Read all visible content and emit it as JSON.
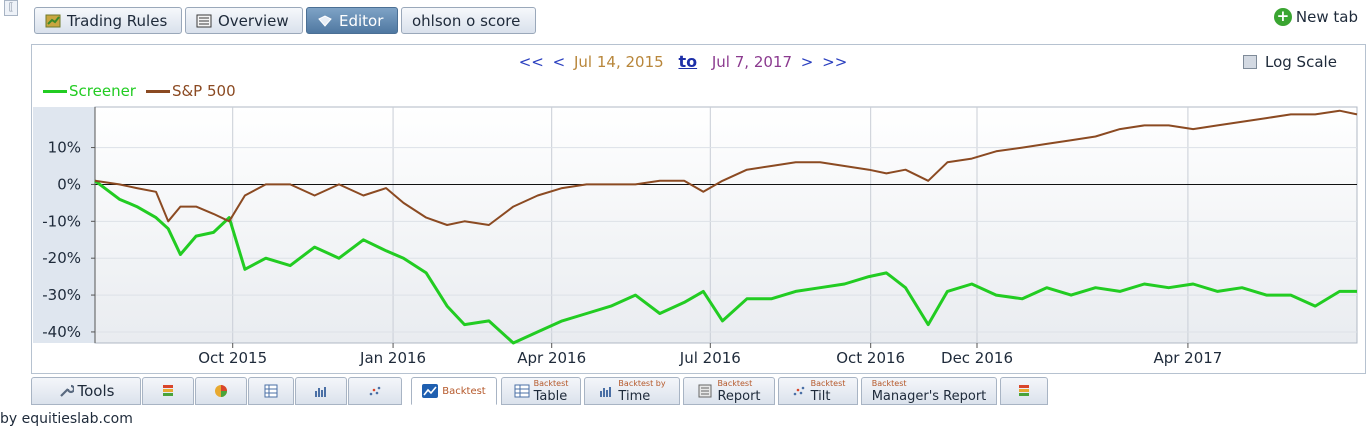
{
  "top_tabs": [
    {
      "label": "Trading Rules",
      "icon": "trading-rules-icon",
      "active": false
    },
    {
      "label": "Overview",
      "icon": "overview-icon",
      "active": false
    },
    {
      "label": "Editor",
      "icon": "editor-icon",
      "active": true
    },
    {
      "label": "ohlson o score",
      "icon": "",
      "active": false
    }
  ],
  "new_tab_label": "New tab",
  "date_range": {
    "first": "<<",
    "prev": "<",
    "start": "Jul 14, 2015",
    "to": "to",
    "end": "Jul 7, 2017",
    "next": ">",
    "last": ">>"
  },
  "log_scale_label": "Log Scale",
  "log_scale_checked": false,
  "bottom_tabs": [
    {
      "small": "",
      "main": "Tools",
      "icon": "wrench-icon"
    },
    {
      "small": "",
      "main": "",
      "icon": "stack-icon"
    },
    {
      "small": "",
      "main": "",
      "icon": "pie-icon"
    },
    {
      "small": "",
      "main": "",
      "icon": "grid-icon"
    },
    {
      "small": "",
      "main": "",
      "icon": "bars-icon"
    },
    {
      "small": "",
      "main": "",
      "icon": "scatter-icon"
    },
    {
      "small": "",
      "main": "Backtest",
      "icon": "line-chart-icon",
      "active": true
    },
    {
      "small": "Backtest",
      "main": "Table",
      "icon": "table-icon"
    },
    {
      "small": "Backtest by",
      "main": "Time",
      "icon": "bars-icon"
    },
    {
      "small": "Backtest",
      "main": "Report",
      "icon": "report-icon"
    },
    {
      "small": "Backtest",
      "main": "Tilt",
      "icon": "scatter-icon"
    },
    {
      "small": "Backtest",
      "main": "Manager's Report",
      "icon": ""
    },
    {
      "small": "",
      "main": "",
      "icon": "stack-icon"
    }
  ],
  "byline": "by equitieslab.com",
  "chart_data": {
    "type": "line",
    "title": "",
    "xlabel": "",
    "ylabel": "",
    "x_tick_labels": [
      "Oct 2015",
      "Jan 2016",
      "Apr 2016",
      "Jul 2016",
      "Oct 2016",
      "Dec 2016",
      "Apr 2017"
    ],
    "x_tick_dates": [
      "2015-10-01",
      "2016-01-01",
      "2016-04-01",
      "2016-07-01",
      "2016-10-01",
      "2016-12-01",
      "2017-04-01"
    ],
    "xlim": [
      "2015-07-14",
      "2017-07-07"
    ],
    "y_tick_labels": [
      "10%",
      "0%",
      "-10%",
      "-20%",
      "-30%",
      "-40%"
    ],
    "y_ticks": [
      10,
      0,
      -10,
      -20,
      -30,
      -40
    ],
    "ylim": [
      -43,
      21
    ],
    "y_unit": "%",
    "grid": true,
    "zero_line": true,
    "legend_position": "top-left",
    "colors": {
      "Screener": "#22cc22",
      "S&P 500": "#8b4a22"
    },
    "series": [
      {
        "name": "Screener",
        "x": [
          "2015-07-14",
          "2015-07-28",
          "2015-08-07",
          "2015-08-18",
          "2015-08-25",
          "2015-09-01",
          "2015-09-10",
          "2015-09-20",
          "2015-09-29",
          "2015-10-08",
          "2015-10-20",
          "2015-11-03",
          "2015-11-17",
          "2015-12-01",
          "2015-12-15",
          "2015-12-28",
          "2016-01-07",
          "2016-01-20",
          "2016-02-01",
          "2016-02-11",
          "2016-02-25",
          "2016-03-10",
          "2016-03-24",
          "2016-04-07",
          "2016-04-21",
          "2016-05-05",
          "2016-05-19",
          "2016-06-02",
          "2016-06-16",
          "2016-06-27",
          "2016-07-08",
          "2016-07-22",
          "2016-08-05",
          "2016-08-19",
          "2016-09-02",
          "2016-09-16",
          "2016-09-30",
          "2016-10-10",
          "2016-10-21",
          "2016-11-03",
          "2016-11-14",
          "2016-11-28",
          "2016-12-12",
          "2016-12-27",
          "2017-01-10",
          "2017-01-24",
          "2017-02-07",
          "2017-02-21",
          "2017-03-07",
          "2017-03-21",
          "2017-04-04",
          "2017-04-18",
          "2017-05-02",
          "2017-05-16",
          "2017-05-30",
          "2017-06-13",
          "2017-06-27",
          "2017-07-07"
        ],
        "values": [
          1,
          -4,
          -6,
          -9,
          -12,
          -19,
          -14,
          -13,
          -9,
          -23,
          -20,
          -22,
          -17,
          -20,
          -15,
          -18,
          -20,
          -24,
          -33,
          -38,
          -37,
          -43,
          -40,
          -37,
          -35,
          -33,
          -30,
          -35,
          -32,
          -29,
          -37,
          -31,
          -31,
          -29,
          -28,
          -27,
          -25,
          -24,
          -28,
          -38,
          -29,
          -27,
          -30,
          -31,
          -28,
          -30,
          -28,
          -29,
          -27,
          -28,
          -27,
          -29,
          -28,
          -30,
          -30,
          -33,
          -29,
          -29
        ]
      },
      {
        "name": "S&P 500",
        "x": [
          "2015-07-14",
          "2015-07-28",
          "2015-08-07",
          "2015-08-18",
          "2015-08-25",
          "2015-09-01",
          "2015-09-10",
          "2015-09-20",
          "2015-09-29",
          "2015-10-08",
          "2015-10-20",
          "2015-11-03",
          "2015-11-17",
          "2015-12-01",
          "2015-12-15",
          "2015-12-28",
          "2016-01-07",
          "2016-01-20",
          "2016-02-01",
          "2016-02-11",
          "2016-02-25",
          "2016-03-10",
          "2016-03-24",
          "2016-04-07",
          "2016-04-21",
          "2016-05-05",
          "2016-05-19",
          "2016-06-02",
          "2016-06-16",
          "2016-06-27",
          "2016-07-08",
          "2016-07-22",
          "2016-08-05",
          "2016-08-19",
          "2016-09-02",
          "2016-09-16",
          "2016-09-30",
          "2016-10-10",
          "2016-10-21",
          "2016-11-03",
          "2016-11-14",
          "2016-11-28",
          "2016-12-12",
          "2016-12-27",
          "2017-01-10",
          "2017-01-24",
          "2017-02-07",
          "2017-02-21",
          "2017-03-07",
          "2017-03-21",
          "2017-04-04",
          "2017-04-18",
          "2017-05-02",
          "2017-05-16",
          "2017-05-30",
          "2017-06-13",
          "2017-06-27",
          "2017-07-07"
        ],
        "values": [
          1,
          0,
          -1,
          -2,
          -10,
          -6,
          -6,
          -8,
          -10,
          -3,
          0,
          0,
          -3,
          0,
          -3,
          -1,
          -5,
          -9,
          -11,
          -10,
          -11,
          -6,
          -3,
          -1,
          0,
          0,
          0,
          1,
          1,
          -2,
          1,
          4,
          5,
          6,
          6,
          5,
          4,
          3,
          4,
          1,
          6,
          7,
          9,
          10,
          11,
          12,
          13,
          15,
          16,
          16,
          15,
          16,
          17,
          18,
          19,
          19,
          20,
          19
        ]
      }
    ]
  }
}
